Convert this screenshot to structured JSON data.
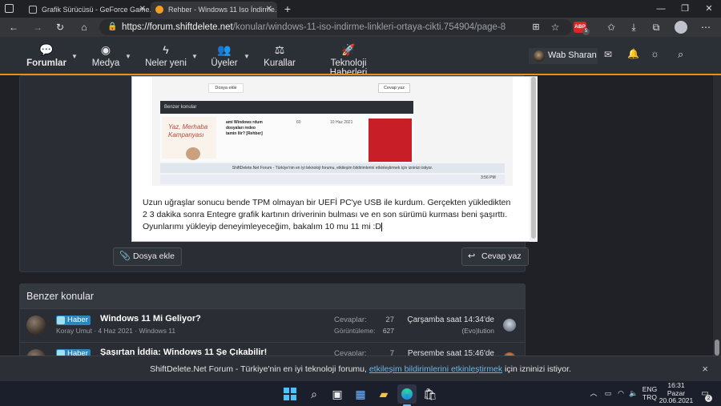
{
  "browser": {
    "tabs": [
      {
        "title": "Grafik Sürücüsü - GeForce Game...",
        "active": false
      },
      {
        "title": "Rehber - Windows 11 Iso İndirme...",
        "active": true
      }
    ],
    "new_tab_glyph": "+",
    "url_host": "https://forum.shiftdelete.net",
    "url_path": "/konular/windows-11-iso-indirme-linkleri-ortaya-cikti.754904/page-8",
    "ext_badge": "ABP",
    "ext_count": "5"
  },
  "forum_nav": {
    "items": [
      {
        "label": "Forumlar",
        "icon": "chat-icon",
        "active": true
      },
      {
        "label": "Medya",
        "icon": "camera-icon"
      },
      {
        "label": "Neler yeni",
        "icon": "bolt-icon"
      },
      {
        "label": "Üyeler",
        "icon": "users-icon"
      },
      {
        "label": "Kurallar",
        "icon": "scales-icon"
      },
      {
        "label": "Teknoloji Haberleri",
        "icon": "rocket-icon"
      }
    ],
    "username": "Wab Sharan"
  },
  "editor": {
    "text": "Uzun uğraşlar sonucu bende TPM olmayan bir UEFİ PC'ye USB ile kurdum.  Gerçekten yükledikten 2 3 dakika sonra Entegre grafik kartının driverinin bulması ve en son sürümü kurması beni şaşırttı. Oyunlarımı yükleyip deneyimleyeceğim, bakalım 10 mu 11 mi :D",
    "attach_label": "Dosya ekle",
    "reply_label": "Cevap yaz"
  },
  "embedded_screenshot": {
    "attach_label": "Dosya ekle",
    "reply_label": "Cevap yaz",
    "similar_label": "Benzer konular",
    "thread_title": "ami Windows rdum dosyaları redeo tamin llir? [Rehber]",
    "banner_text": "Yaz, Merhaba Kampanyası",
    "cookie_text": "ShiftDelete.Net Forum - Türkiye'nin en iyi teknoloji forumu, etkileşim bildirimlerini etkinleştirmek için izninizi istiyor.",
    "count_replies": "60",
    "date": "10 Haz 2021",
    "clock": "3:56 PM"
  },
  "similar": {
    "heading": "Benzer konular",
    "rows": [
      {
        "badge": "Haber",
        "title": "Windows 11 Mi Geliyor?",
        "meta": "Koray Umut · 4 Haz 2021 · Windows 11",
        "replies_label": "Cevaplar:",
        "replies": "27",
        "views_label": "Görüntüleme:",
        "views": "627",
        "last_date": "Çarşamba saat 14:34'de",
        "last_user": "(Evo)lution"
      },
      {
        "badge": "Haber",
        "title": "Şaşırtan İddia: Windows 11 Şe Çıkabilir!",
        "meta": "",
        "replies_label": "Cevaplar:",
        "replies": "7",
        "views_label": "",
        "views": "",
        "last_date": "Perşembe saat 15:46'de",
        "last_user": ""
      }
    ]
  },
  "cookie_bar": {
    "prefix": "ShiftDelete.Net Forum - Türkiye'nin en iyi teknoloji forumu, ",
    "link": "etkileşim bildirimlerini etkinleştirmek",
    "suffix": " için izninizi istiyor.",
    "close": "×"
  },
  "taskbar": {
    "lang1": "ENG",
    "lang2": "TRQ",
    "time": "16:31",
    "day": "Pazar",
    "date": "20.06.2021",
    "notif_count": "2"
  }
}
